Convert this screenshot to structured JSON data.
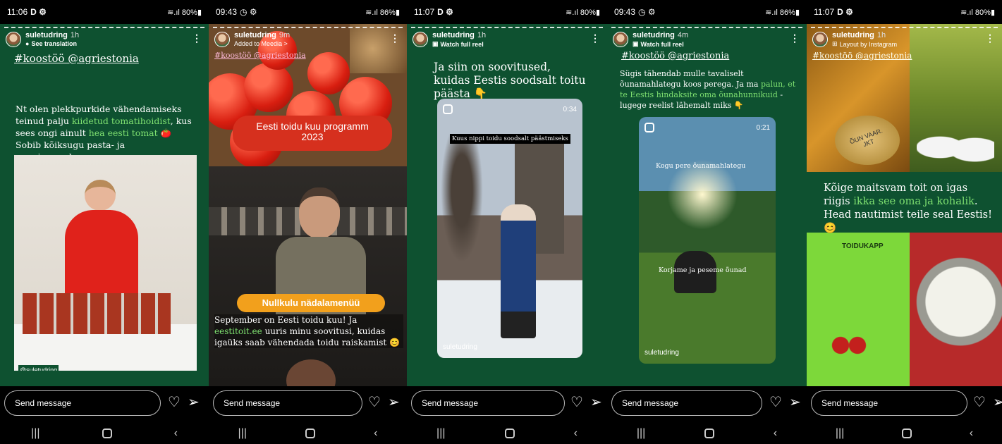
{
  "send_message_placeholder": "Send message",
  "panels": [
    {
      "status_time": "11:06",
      "status_right": "≋.ıl 80%▮",
      "username": "suletudring",
      "time_ago": "1h",
      "subtitle": "See translation",
      "tag": "#koostöö @agriestonia",
      "text_parts": [
        "Nt olen plekkpurkide vähendamiseks teinud palju ",
        "kiidetud tomatihoidist",
        ", kus sees ongi ainult ",
        "hea eesti tomat",
        " 🍅 Sobib kõiksugu pasta- ja panniroogadesse."
      ],
      "watermark": "@suletudring"
    },
    {
      "status_time": "09:43",
      "status_right": "≋.ıl 86%▮",
      "username": "suletudring",
      "time_ago": "9m",
      "subtitle": "Added to Meedia >",
      "tag": "#koostöö @agriestonia",
      "banner": "Eesti toidu kuu programm 2023",
      "orange_label": "Nullkulu nädalamenüü",
      "text_parts": [
        "September on Eesti toidu kuu! Ja ",
        "eestitoit.ee",
        " uuris minu soovitusi, kuidas igaüks saab vähendada toidu raiskamist 😊"
      ]
    },
    {
      "status_time": "11:07",
      "status_right": "≋.ıl 80%▮",
      "username": "suletudring",
      "time_ago": "1h",
      "subtitle": "Watch full reel",
      "headline": "Ja siin on soovitused, kuidas Eestis soodsalt toitu päästa 👇",
      "video_caption": "Kuus nippi toidu soodsalt päästmiseks",
      "video_time": "0:34",
      "watermark": "suletudring"
    },
    {
      "status_time": "09:43",
      "status_right": "≋.ıl 86%▮",
      "username": "suletudring",
      "time_ago": "4m",
      "subtitle": "Watch full reel",
      "tag": "#koostöö @agriestonia",
      "text_parts": [
        "Sügis tähendab mulle tavaliselt õunamahlategu koos perega. Ja ma ",
        "palun, et te Eestis hindaksite oma õunahunnikuid",
        " - lugege reelist lähemalt miks 👇"
      ],
      "video_caption1": "Kogu pere õunamahlategu",
      "video_caption2": "Korjame ja peseme õunad",
      "video_time": "0:21",
      "watermark": "suletudring"
    },
    {
      "status_time": "11:07",
      "status_right": "≋.ıl 80%▮",
      "username": "suletudring",
      "time_ago": "1h",
      "subtitle": "Layout by Instagram",
      "tag": "#koostöö @agriestonia",
      "jar_label": "ÕUN VAAR. JKT",
      "text_parts": [
        "Kõige maitsvam toit on igas riigis ",
        "ikka see oma ja kohalik",
        ". Head nautimist teile seal Eestis! 😊"
      ],
      "locker_label": "TOIDUKAPP"
    }
  ]
}
